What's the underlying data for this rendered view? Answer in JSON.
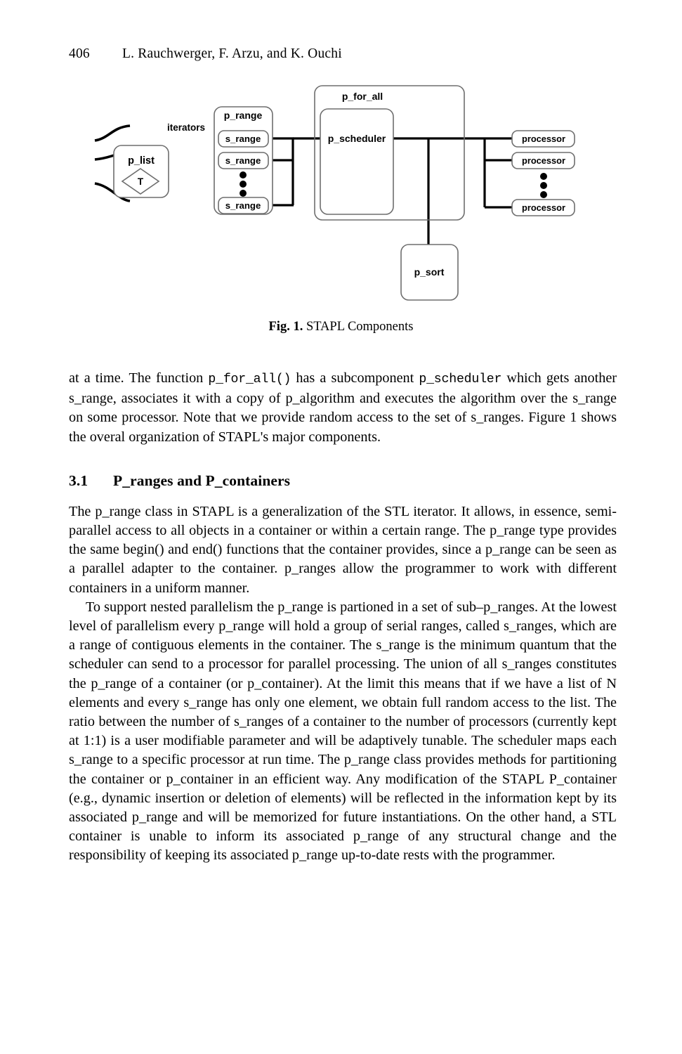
{
  "header": {
    "page_number": "406",
    "running_head": "L. Rauchwerger, F. Arzu, and K. Ouchi"
  },
  "figure": {
    "caption_number": "Fig. 1.",
    "caption_text": " STAPL Components",
    "nodes": {
      "p_list": "p_list",
      "p_list_type": "T",
      "iterators_label": "iterators",
      "p_range": "p_range",
      "s_range_1": "s_range",
      "s_range_2": "s_range",
      "s_range_3": "s_range",
      "p_for_all": "p_for_all",
      "p_scheduler": "p_scheduler",
      "processor_1": "processor",
      "processor_2": "processor",
      "processor_3": "processor",
      "p_sort": "p_sort"
    },
    "stroke_color": "#000000",
    "box_outline_color": "#6e6e6e"
  },
  "body": {
    "paragraph_1": "at a time. The function p_for_all() has a subcomponent p_scheduler which gets another s_range, associates it with a copy of p_algorithm and executes the algorithm over the s_range on some processor. Note that we provide random access to the set of s_ranges. Figure  1 shows the overal organization of STAPL's major components.",
    "paragraph_1_pre": "at a time. The function ",
    "paragraph_1_code_1": "p_for_all()",
    "paragraph_1_mid": " has a subcomponent ",
    "paragraph_1_code_2": "p_scheduler",
    "paragraph_1_post": " which gets another s_range, associates it with a copy of p_algorithm and executes the algorithm over the s_range on some processor. Note that we provide random access to the set of s_ranges. Figure  1 shows the overal organization of STAPL's major components.",
    "section_number": "3.1",
    "section_title": "P_ranges and P_containers",
    "paragraph_2": "The p_range class in STAPL is a generalization of the STL iterator. It allows, in essence, semi-parallel access to all objects in a container or within a certain range. The p_range type provides the same begin() and end() functions that the container provides, since a p_range can be seen as a parallel adapter to the container. p_ranges allow the programmer to work with different containers in a uniform manner.",
    "paragraph_3": "To support nested parallelism the p_range is partioned in a set of sub–p_ranges. At the lowest level of parallelism every p_range will hold a group of serial ranges, called s_ranges, which are a range of contiguous elements in the container. The s_range is the minimum quantum that the scheduler can send to a processor for parallel processing. The union of all s_ranges constitutes the p_range of a container (or p_container). At the limit this means that if we have a list of N elements and every s_range has only one element, we obtain full random access to the list. The ratio between the number of s_ranges of a container to the number of processors (currently kept at 1:1) is a user modifiable parameter and will be adaptively tunable. The scheduler maps each s_range to a specific processor at run time. The p_range class provides methods for partitioning the container or p_container in an efficient way. Any modification of the STAPL P_container (e.g., dynamic insertion or deletion of elements) will be reflected in the information kept by its associated p_range and will be memorized for future instantiations. On the other hand, a STL container is unable to inform its associated p_range of any structural change and the responsibility of keeping its associated p_range up-to-date rests with the programmer."
  }
}
